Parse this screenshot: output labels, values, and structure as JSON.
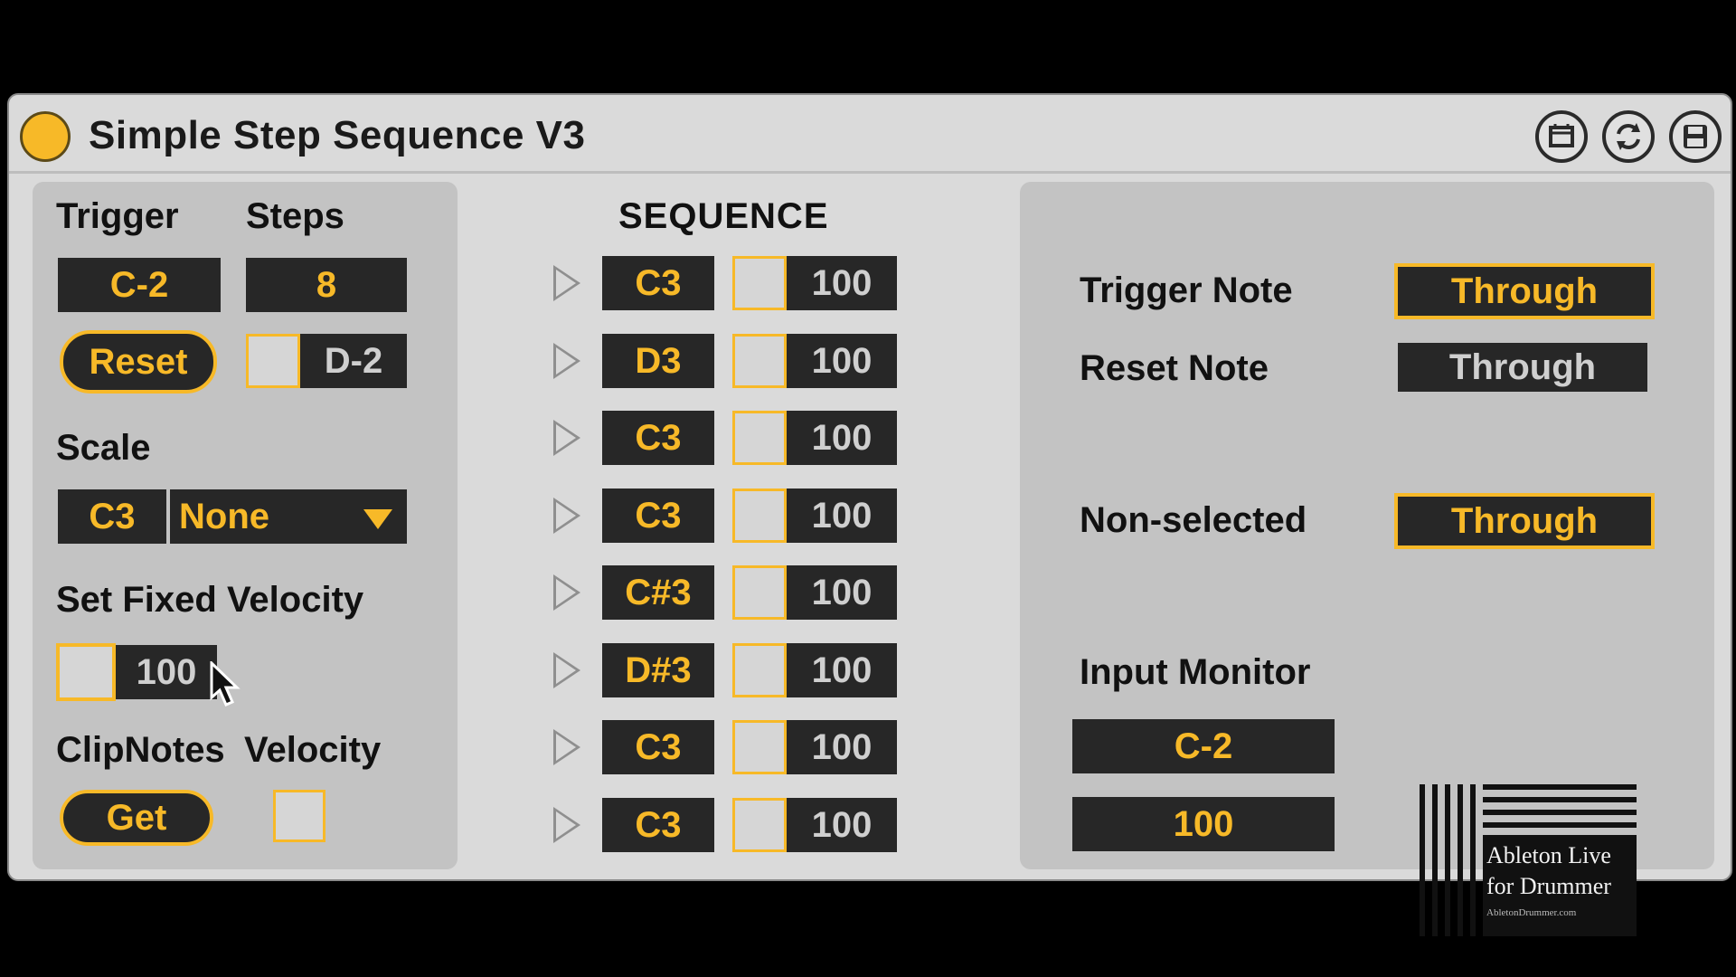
{
  "title": "Simple Step Sequence V3",
  "colors": {
    "accent": "#f7b928",
    "field": "#272727",
    "panel": "#c3c3c3",
    "body": "#dadada"
  },
  "titlebar_icons": [
    "freeze-icon",
    "hot-swap-icon",
    "save-icon"
  ],
  "left": {
    "trigger_label": "Trigger",
    "steps_label": "Steps",
    "trigger_value": "C-2",
    "steps_value": "8",
    "reset_label": "Reset",
    "reset_note_value": "D-2",
    "scale_label": "Scale",
    "scale_root": "C3",
    "scale_type": "None",
    "fixed_velocity_label": "Set Fixed Velocity",
    "fixed_velocity_value": "100",
    "clipnotes_label": "ClipNotes",
    "velocity_label": "Velocity",
    "get_label": "Get"
  },
  "sequence": {
    "heading": "SEQUENCE",
    "steps": [
      {
        "note": "C3",
        "velocity": "100"
      },
      {
        "note": "D3",
        "velocity": "100"
      },
      {
        "note": "C3",
        "velocity": "100"
      },
      {
        "note": "C3",
        "velocity": "100"
      },
      {
        "note": "C#3",
        "velocity": "100"
      },
      {
        "note": "D#3",
        "velocity": "100"
      },
      {
        "note": "C3",
        "velocity": "100"
      },
      {
        "note": "C3",
        "velocity": "100"
      }
    ]
  },
  "right": {
    "trigger_note_label": "Trigger Note",
    "trigger_note_value": "Through",
    "reset_note_label": "Reset Note",
    "reset_note_value": "Through",
    "non_selected_label": "Non-selected",
    "non_selected_value": "Through",
    "input_monitor_label": "Input Monitor",
    "input_monitor_note": "C-2",
    "input_monitor_velocity": "100"
  },
  "logo": {
    "line1": "Ableton Live",
    "line2": "for Drummer",
    "line3": "AbletonDrummer.com"
  }
}
